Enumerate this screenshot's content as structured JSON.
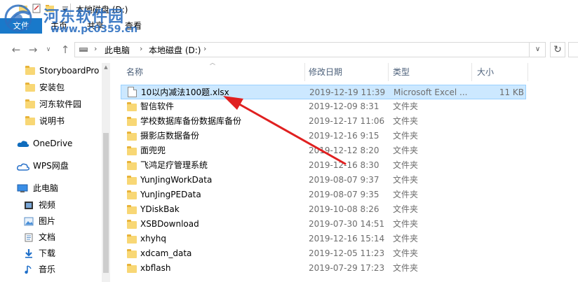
{
  "window": {
    "title": "本地磁盘 (D:)"
  },
  "ribbon": {
    "file": "文件",
    "tabs": [
      "主页",
      "共享",
      "查看"
    ]
  },
  "watermark": {
    "title": "河东软件园",
    "url": "www.pc0359.cn"
  },
  "nav": {
    "back": "←",
    "forward": "→",
    "recent": "∨",
    "up": "↑",
    "breadcrumb": [
      "此电脑",
      "本地磁盘 (D:)"
    ],
    "separator": "›",
    "dropdown": "∨",
    "refresh": "↻"
  },
  "sidebar": {
    "folders": [
      "StoryboardPro",
      "安装包",
      "河东软件园",
      "说明书"
    ],
    "places": [
      "OneDrive",
      "WPS网盘",
      "此电脑"
    ],
    "pc_items": [
      "视频",
      "图片",
      "文档",
      "下载",
      "音乐"
    ]
  },
  "columns": {
    "name": "名称",
    "date": "修改日期",
    "type": "类型",
    "size": "大小"
  },
  "files": [
    {
      "name": "10以内减法100题.xlsx",
      "date": "2019-12-19 11:39",
      "type": "Microsoft Excel ...",
      "size": "11 KB",
      "kind": "xlsx",
      "selected": true
    },
    {
      "name": "智信软件",
      "date": "2019-12-09 8:31",
      "type": "文件夹",
      "size": "",
      "kind": "folder"
    },
    {
      "name": "学校数据库备份数据库备份",
      "date": "2019-12-17 11:06",
      "type": "文件夹",
      "size": "",
      "kind": "folder"
    },
    {
      "name": "摄影店数据备份",
      "date": "2019-12-16 9:15",
      "type": "文件夹",
      "size": "",
      "kind": "folder"
    },
    {
      "name": "面兜兜",
      "date": "2019-12-12 8:20",
      "type": "文件夹",
      "size": "",
      "kind": "folder"
    },
    {
      "name": "飞鸿足疗管理系统",
      "date": "2019-12-16 8:30",
      "type": "文件夹",
      "size": "",
      "kind": "folder"
    },
    {
      "name": "YunJingWorkData",
      "date": "2019-08-07 9:37",
      "type": "文件夹",
      "size": "",
      "kind": "folder"
    },
    {
      "name": "YunJingPEData",
      "date": "2019-08-07 9:35",
      "type": "文件夹",
      "size": "",
      "kind": "folder"
    },
    {
      "name": "YDiskBak",
      "date": "2019-10-08 8:26",
      "type": "文件夹",
      "size": "",
      "kind": "folder"
    },
    {
      "name": "XSBDownload",
      "date": "2019-07-30 14:51",
      "type": "文件夹",
      "size": "",
      "kind": "folder"
    },
    {
      "name": "xhyhq",
      "date": "2019-12-16 15:14",
      "type": "文件夹",
      "size": "",
      "kind": "folder"
    },
    {
      "name": "xdcam_data",
      "date": "2019-12-05 11:23",
      "type": "文件夹",
      "size": "",
      "kind": "folder"
    },
    {
      "name": "xbflash",
      "date": "2019-07-29 17:23",
      "type": "文件夹",
      "size": "",
      "kind": "folder"
    }
  ],
  "colors": {
    "accent": "#1979ca",
    "selection": "#cce8ff",
    "annotation_arrow": "#e02020"
  }
}
